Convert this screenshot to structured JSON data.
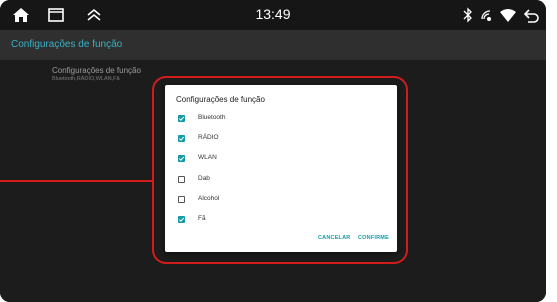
{
  "statusbar": {
    "time": "13:49",
    "icons_left": [
      "home-icon",
      "recents-icon",
      "collapse-icon"
    ],
    "icons_right": [
      "bluetooth-icon",
      "signal-icon",
      "wifi-icon",
      "back-icon"
    ]
  },
  "appbar": {
    "title": "Configurações de função"
  },
  "preference": {
    "title": "Configurações de função",
    "summary": "Bluetooth,RÁDIO,WLAN,Fã"
  },
  "dialog": {
    "title": "Configurações de função",
    "options": [
      {
        "label": "Bluetooth",
        "checked": true
      },
      {
        "label": "RÁDIO",
        "checked": true
      },
      {
        "label": "WLAN",
        "checked": true
      },
      {
        "label": "Dab",
        "checked": false
      },
      {
        "label": "Alcohol",
        "checked": false
      },
      {
        "label": "Fã",
        "checked": true
      }
    ],
    "cancel_label": "CANCELAR",
    "confirm_label": "CONFIRME"
  },
  "colors": {
    "accent": "#159aa8",
    "title_accent": "#35b4c7",
    "callout": "#d21b1b"
  }
}
